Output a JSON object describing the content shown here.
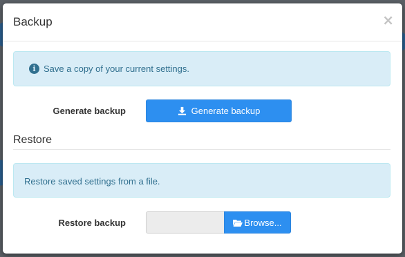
{
  "modal": {
    "title": "Backup",
    "close_label": "×"
  },
  "backup": {
    "info_text": "Save a copy of your current settings.",
    "info_icon": "info-circle-icon",
    "row_label": "Generate backup",
    "button_label": "Generate backup",
    "button_icon": "download-icon"
  },
  "restore": {
    "section_title": "Restore",
    "info_text": "Restore saved settings from a file.",
    "row_label": "Restore backup",
    "file_value": "",
    "browse_label": "Browse...",
    "browse_icon": "folder-open-icon"
  },
  "colors": {
    "primary": "#2d8ff0",
    "info_bg": "#d9edf7",
    "info_text": "#31708f"
  }
}
